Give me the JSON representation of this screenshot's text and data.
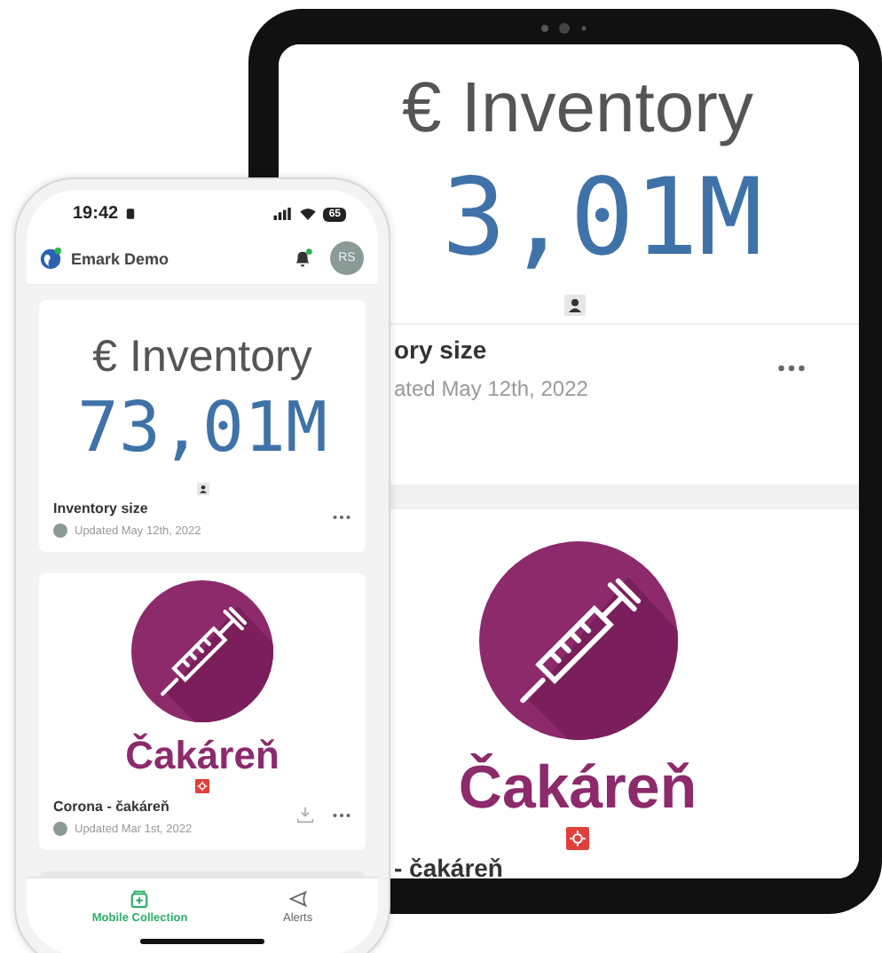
{
  "tablet": {
    "cards": [
      {
        "kind": "kpi",
        "title": "€ Inventory",
        "value": "3,01M",
        "label": "ory size",
        "updated": "ated May 12th, 2022"
      },
      {
        "kind": "image",
        "title": "Čakáreň",
        "label": "- čakáreň"
      }
    ]
  },
  "phone": {
    "status_bar": {
      "time": "19:42",
      "battery": "65"
    },
    "header": {
      "app_name": "Emark Demo",
      "avatar": "RS"
    },
    "cards": [
      {
        "kind": "kpi",
        "title": "€ Inventory",
        "value": "73,01M",
        "label": "Inventory size",
        "updated": "Updated May 12th, 2022"
      },
      {
        "kind": "image",
        "title": "Čakáreň",
        "label": "Corona - čakáreň",
        "updated": "Updated Mar 1st, 2022"
      }
    ],
    "bottom_nav": [
      {
        "label": "Mobile Collection",
        "selected": true
      },
      {
        "label": "Alerts",
        "selected": false
      }
    ]
  }
}
